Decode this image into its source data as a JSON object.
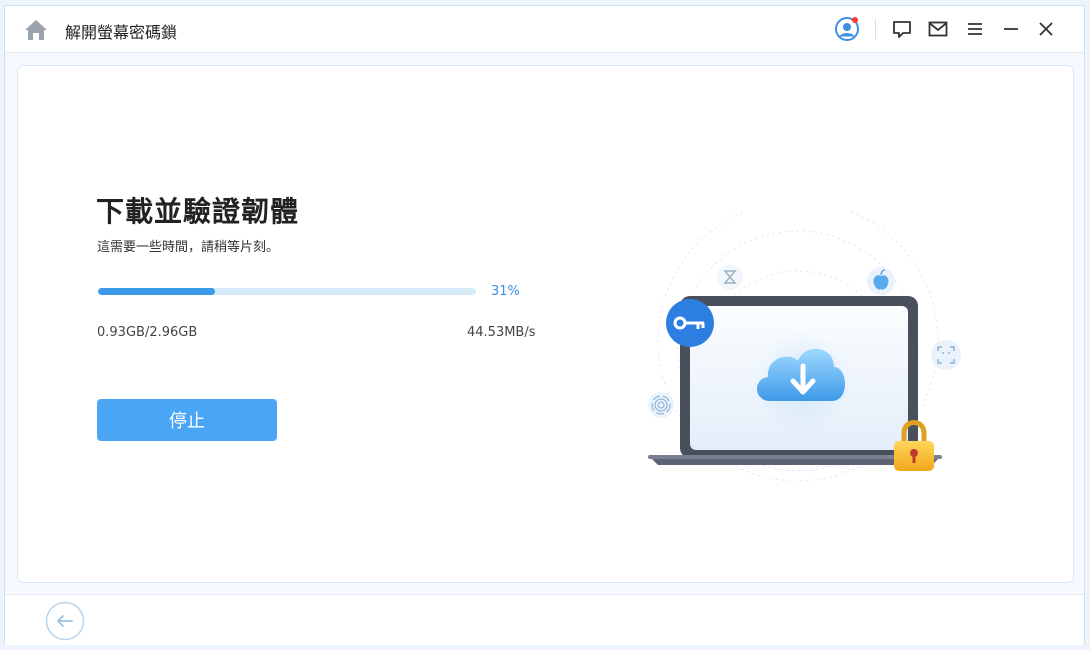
{
  "window": {
    "title": "解開螢幕密碼鎖"
  },
  "toolbar": {
    "icons": [
      "home-icon",
      "user-avatar-icon",
      "feedback-icon",
      "mail-icon",
      "menu-icon",
      "minimize-icon",
      "close-icon"
    ],
    "notification_color": "#ff3b30"
  },
  "main": {
    "heading": "下載並驗證韌體",
    "subtext": "這需要一些時間，請稍等片刻。",
    "progress": {
      "percent_label": "31%",
      "value": 0.31
    },
    "downloaded": "0.93GB/2.96GB",
    "speed": "44.53MB/s",
    "stop_label": "停止"
  },
  "illustration": {
    "icons": [
      "laptop-icon",
      "cloud-download-icon",
      "key-icon",
      "padlock-icon",
      "hourglass-icon",
      "apple-icon",
      "face-id-icon",
      "fingerprint-icon"
    ]
  },
  "footer": {
    "back_icon": "back-arrow-icon"
  },
  "colors": {
    "accent": "#4aa6f4",
    "progress": "#3d9ae8",
    "track": "#d7eaf8"
  }
}
